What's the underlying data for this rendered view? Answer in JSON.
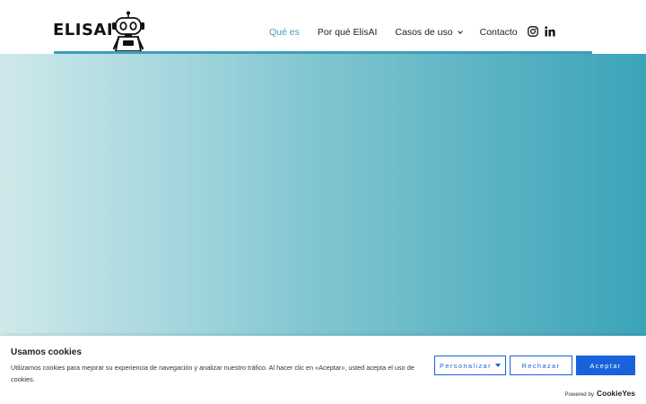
{
  "header": {
    "logo_text": "ELISAI",
    "nav": [
      {
        "label": "Qué es",
        "active": true
      },
      {
        "label": "Por qué ElisAI",
        "active": false
      },
      {
        "label": "Casos de uso",
        "active": false,
        "has_dropdown": true
      },
      {
        "label": "Contacto",
        "active": false
      }
    ],
    "social": [
      "instagram-icon",
      "linkedin-icon"
    ]
  },
  "colors": {
    "accent": "#3aa0b8",
    "gradient_start": "#cfe9ea",
    "gradient_end": "#3ba4b8",
    "cookie_button": "#1863dc"
  },
  "cookie_banner": {
    "title": "Usamos cookies",
    "text": "Utilizamos cookies para mejorar su experiencia de navegación y analizar nuestro tráfico. Al hacer clic en «Aceptar», usted acepta el uso de cookies.",
    "customize_label": "Personalizar",
    "reject_label": "Rechazar",
    "accept_label": "Aceptar",
    "powered_by": "Powered by",
    "powered_brand": "CookieYes"
  }
}
